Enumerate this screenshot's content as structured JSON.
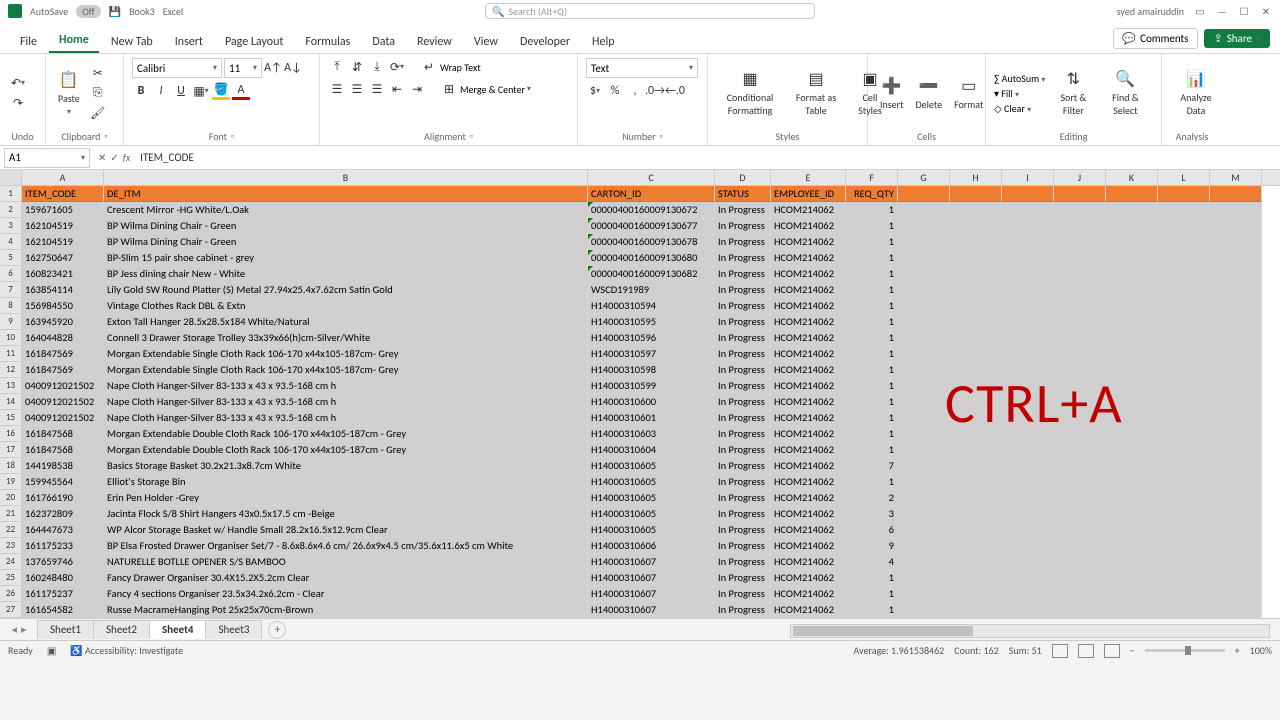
{
  "titlebar": {
    "autosave": "AutoSave",
    "autosave_state": "Off",
    "doc": "Book3",
    "app": "Excel",
    "search_ph": "Search (Alt+Q)",
    "user": "syed amairuddin"
  },
  "tabs": [
    "File",
    "Home",
    "New Tab",
    "Insert",
    "Page Layout",
    "Formulas",
    "Data",
    "Review",
    "View",
    "Developer",
    "Help"
  ],
  "active_tab": "Home",
  "header_buttons": {
    "comments": "Comments",
    "share": "Share"
  },
  "ribbon": {
    "undo": "Undo",
    "clipboard": "Clipboard",
    "paste": "Paste",
    "font": "Font",
    "font_name": "Calibri",
    "font_size": "11",
    "alignment": "Alignment",
    "wrap": "Wrap Text",
    "merge": "Merge & Center",
    "number": "Number",
    "num_format": "Text",
    "styles": "Styles",
    "cond": "Conditional Formatting",
    "fmt_table": "Format as Table",
    "cell_styles": "Cell Styles",
    "cells": "Cells",
    "insert": "Insert",
    "delete": "Delete",
    "format": "Format",
    "editing": "Editing",
    "autosum": "AutoSum",
    "fill": "Fill",
    "clear": "Clear",
    "sort": "Sort & Filter",
    "find": "Find & Select",
    "analysis": "Analysis",
    "analyze": "Analyze Data"
  },
  "formula_bar": {
    "cell_ref": "A1",
    "formula": "ITEM_CODE"
  },
  "columns": [
    "A",
    "B",
    "C",
    "D",
    "E",
    "F",
    "G",
    "H",
    "I",
    "J",
    "K",
    "L",
    "M"
  ],
  "headers": {
    "A": "ITEM_CODE",
    "B": "DE_ITM",
    "C": "CARTON_ID",
    "D": "STATUS",
    "E": "EMPLOYEE_ID",
    "F": "REQ_QTY"
  },
  "rows": [
    {
      "n": 2,
      "A": "159671605",
      "B": "Crescent Mirror -HG White/L.Oak",
      "C": "00000400160009130672",
      "D": "In Progress",
      "E": "HCOM214062",
      "F": "1",
      "g": true
    },
    {
      "n": 3,
      "A": "162104519",
      "B": "BP Wilma Dining Chair - Green",
      "C": "00000400160009130677",
      "D": "In Progress",
      "E": "HCOM214062",
      "F": "1",
      "g": true
    },
    {
      "n": 4,
      "A": "162104519",
      "B": "BP Wilma Dining Chair - Green",
      "C": "00000400160009130678",
      "D": "In Progress",
      "E": "HCOM214062",
      "F": "1",
      "g": true
    },
    {
      "n": 5,
      "A": "162750647",
      "B": "BP-Slim 15 pair shoe cabinet - grey",
      "C": "00000400160009130680",
      "D": "In Progress",
      "E": "HCOM214062",
      "F": "1",
      "g": true
    },
    {
      "n": 6,
      "A": "160823421",
      "B": "BP Jess dining chair New - White",
      "C": "00000400160009130682",
      "D": "In Progress",
      "E": "HCOM214062",
      "F": "1",
      "g": true
    },
    {
      "n": 7,
      "A": "163854114",
      "B": "Lily Gold SW Round Platter (S) Metal 27.94x25.4x7.62cm Satin Gold",
      "C": "WSCD191989",
      "D": "In Progress",
      "E": "HCOM214062",
      "F": "1"
    },
    {
      "n": 8,
      "A": "156984550",
      "B": "Vintage Clothes Rack DBL & Extn",
      "C": "H14000310594",
      "D": "In Progress",
      "E": "HCOM214062",
      "F": "1"
    },
    {
      "n": 9,
      "A": "163945920",
      "B": "Exton Tall Hanger 28.5x28.5x184 White/Natural",
      "C": "H14000310595",
      "D": "In Progress",
      "E": "HCOM214062",
      "F": "1"
    },
    {
      "n": 10,
      "A": "164044828",
      "B": "Connell 3 Drawer Storage Trolley 33x39x66(h)cm-Silver/White",
      "C": "H14000310596",
      "D": "In Progress",
      "E": "HCOM214062",
      "F": "1"
    },
    {
      "n": 11,
      "A": "161847569",
      "B": "Morgan Extendable Single Cloth Rack 106-170 x44x105-187cm- Grey",
      "C": "H14000310597",
      "D": "In Progress",
      "E": "HCOM214062",
      "F": "1"
    },
    {
      "n": 12,
      "A": "161847569",
      "B": "Morgan Extendable Single Cloth Rack 106-170 x44x105-187cm- Grey",
      "C": "H14000310598",
      "D": "In Progress",
      "E": "HCOM214062",
      "F": "1"
    },
    {
      "n": 13,
      "A": "0400912021502",
      "B": "Nape Cloth Hanger-Silver 83-133 x 43 x 93.5-168 cm h",
      "C": "H14000310599",
      "D": "In Progress",
      "E": "HCOM214062",
      "F": "1"
    },
    {
      "n": 14,
      "A": "0400912021502",
      "B": "Nape Cloth Hanger-Silver 83-133 x 43 x 93.5-168 cm h",
      "C": "H14000310600",
      "D": "In Progress",
      "E": "HCOM214062",
      "F": "1"
    },
    {
      "n": 15,
      "A": "0400912021502",
      "B": "Nape Cloth Hanger-Silver 83-133 x 43 x 93.5-168 cm h",
      "C": "H14000310601",
      "D": "In Progress",
      "E": "HCOM214062",
      "F": "1"
    },
    {
      "n": 16,
      "A": "161847568",
      "B": "Morgan Extendable Double Cloth Rack 106-170 x44x105-187cm - Grey",
      "C": "H14000310603",
      "D": "In Progress",
      "E": "HCOM214062",
      "F": "1"
    },
    {
      "n": 17,
      "A": "161847568",
      "B": "Morgan Extendable Double Cloth Rack 106-170 x44x105-187cm - Grey",
      "C": "H14000310604",
      "D": "In Progress",
      "E": "HCOM214062",
      "F": "1"
    },
    {
      "n": 18,
      "A": "144198538",
      "B": "Basics Storage Basket 30.2x21.3x8.7cm White",
      "C": "H14000310605",
      "D": "In Progress",
      "E": "HCOM214062",
      "F": "7"
    },
    {
      "n": 19,
      "A": "159945564",
      "B": "Elliot's Storage Bin",
      "C": "H14000310605",
      "D": "In Progress",
      "E": "HCOM214062",
      "F": "1"
    },
    {
      "n": 20,
      "A": "161766190",
      "B": "Erin Pen Holder -Grey",
      "C": "H14000310605",
      "D": "In Progress",
      "E": "HCOM214062",
      "F": "2"
    },
    {
      "n": 21,
      "A": "162372809",
      "B": "Jacinta Flock S/8 Shirt Hangers 43x0.5x17.5 cm -Beige",
      "C": "H14000310605",
      "D": "In Progress",
      "E": "HCOM214062",
      "F": "3"
    },
    {
      "n": 22,
      "A": "164447673",
      "B": "WP Alcor Storage Basket w/ Handle Small 28.2x16.5x12.9cm Clear",
      "C": "H14000310605",
      "D": "In Progress",
      "E": "HCOM214062",
      "F": "6"
    },
    {
      "n": 23,
      "A": "161175233",
      "B": "BP Elsa Frosted Drawer Organiser Set/7 - 8.6x8.6x4.6 cm/ 26.6x9x4.5 cm/35.6x11.6x5 cm White",
      "C": "H14000310606",
      "D": "In Progress",
      "E": "HCOM214062",
      "F": "9"
    },
    {
      "n": 24,
      "A": "137659746",
      "B": "NATURELLE BOTLLE OPENER S/S   BAMBOO",
      "C": "H14000310607",
      "D": "In Progress",
      "E": "HCOM214062",
      "F": "4"
    },
    {
      "n": 25,
      "A": "160248480",
      "B": "Fancy Drawer Organiser 30.4X15.2X5.2cm Clear",
      "C": "H14000310607",
      "D": "In Progress",
      "E": "HCOM214062",
      "F": "1"
    },
    {
      "n": 26,
      "A": "161175237",
      "B": "Fancy 4 sections Organiser 23.5x34.2x6.2cm  - Clear",
      "C": "H14000310607",
      "D": "In Progress",
      "E": "HCOM214062",
      "F": "1"
    },
    {
      "n": 27,
      "A": "161654582",
      "B": "Russe MacrameHanging Pot 25x25x70cm-Brown",
      "C": "H14000310607",
      "D": "In Progress",
      "E": "HCOM214062",
      "F": "1"
    }
  ],
  "overlay": "CTRL+A",
  "sheets": [
    "Sheet1",
    "Sheet2",
    "Sheet4",
    "Sheet3"
  ],
  "active_sheet": "Sheet4",
  "status": {
    "ready": "Ready",
    "access": "Accessibility: Investigate",
    "avg": "Average: 1.961538462",
    "count": "Count: 162",
    "sum": "Sum: 51",
    "zoom": "100%"
  }
}
